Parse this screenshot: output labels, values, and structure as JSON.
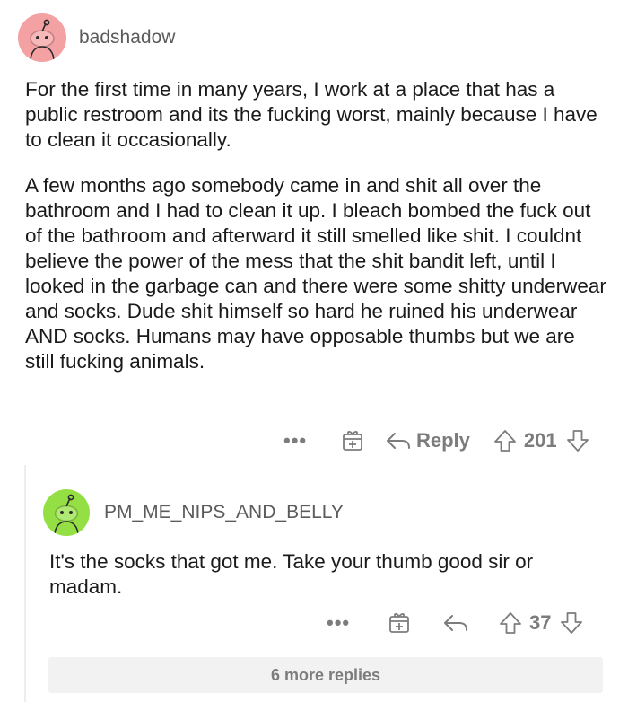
{
  "comment": {
    "username": "badshadow",
    "avatar_color": "#f4a1a3",
    "paragraphs": [
      "For the first time in many years, I work at a place that has a public restroom and its the fucking worst, mainly because I have to clean it occasionally.",
      "A few months ago somebody came in and shit all over the bathroom and I had to clean it up. I bleach bombed the fuck out of the bathroom and afterward it still smelled like shit. I couldnt believe the power of the mess that the shit bandit left, until I looked in the garbage can and there were some shitty underwear and socks. Dude shit himself so hard he ruined his underwear AND socks. Humans may have opposable thumbs but we are still fucking animals."
    ],
    "more_label": "•••",
    "reply_label": "Reply",
    "score": "201",
    "icons": [
      "more-icon",
      "award-icon",
      "reply-icon",
      "upvote-icon",
      "downvote-icon"
    ]
  },
  "reply": {
    "username": "PM_ME_NIPS_AND_BELLY",
    "avatar_color": "#94e044",
    "paragraphs": [
      "It's the socks that got me. Take your thumb good sir or madam."
    ],
    "more_label": "•••",
    "score": "37"
  },
  "more_replies_label": "6 more replies"
}
